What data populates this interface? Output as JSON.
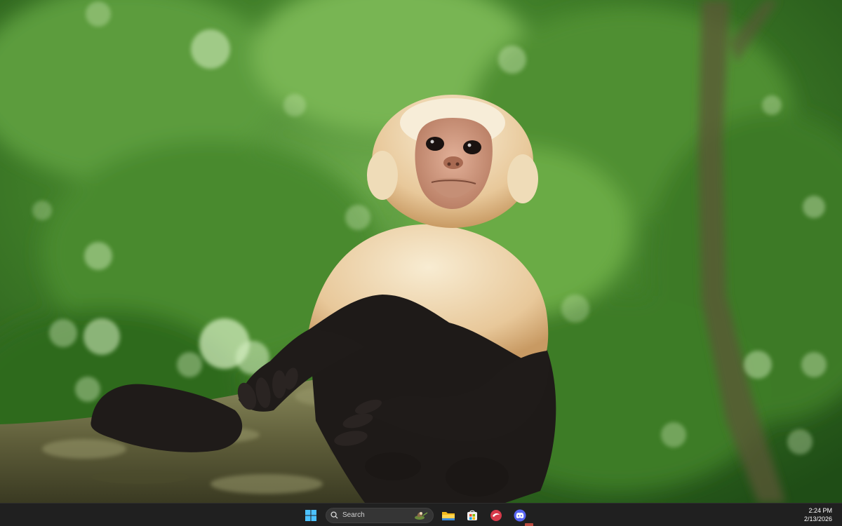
{
  "wallpaper": {
    "subject": "white-faced capuchin monkey on a mossy branch",
    "colors": {
      "foliage_dark": "#2f6a1f",
      "foliage_mid": "#4d8f33",
      "foliage_light": "#8fc863",
      "fur_light": "#f4e3c1",
      "fur_dark": "#1e1a18",
      "face": "#d9a487",
      "branch": "#6b6a45"
    }
  },
  "taskbar": {
    "background": "#202020",
    "start_icon": "windows-logo-icon",
    "search": {
      "placeholder": "Search",
      "icon": "search-icon",
      "decoration": "search-highlight-illustration-icon"
    },
    "apps": [
      {
        "name": "File Explorer",
        "icon": "file-explorer-icon"
      },
      {
        "name": "Microsoft Store",
        "icon": "microsoft-store-icon"
      },
      {
        "name": "App",
        "icon": "red-app-icon"
      },
      {
        "name": "Discord",
        "icon": "discord-icon"
      }
    ],
    "clock": {
      "time": "2:24 PM",
      "date": "2/13/2026"
    }
  }
}
